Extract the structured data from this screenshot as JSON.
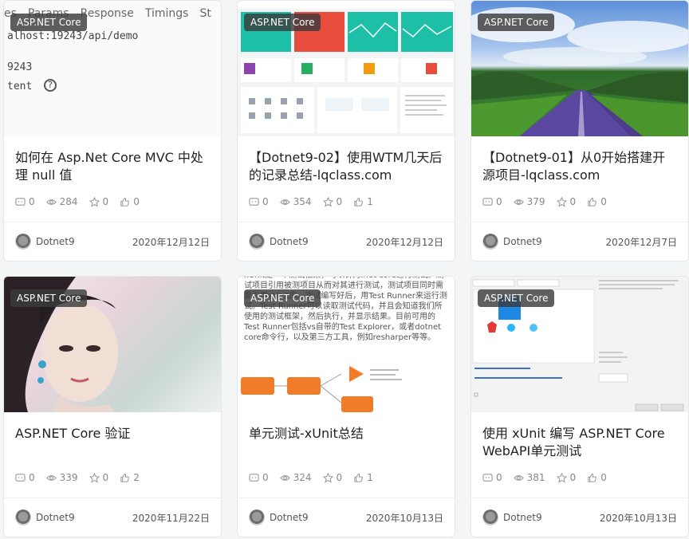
{
  "cards": [
    {
      "tag": "ASP.NET Core",
      "title": "如何在 Asp.Net Core MVC 中处理 null 值",
      "comments": "0",
      "views": "284",
      "stars": "0",
      "likes": "0",
      "author": "Dotnet9",
      "date": "2020年12月12日",
      "thumb_text": {
        "tabs": [
          "es",
          "Params",
          "Response",
          "Timings",
          "St"
        ],
        "lines": [
          "alhost:19243/api/demo",
          "9243",
          "tent"
        ]
      }
    },
    {
      "tag": "ASP.NET Core",
      "title": "【Dotnet9-02】使用WTM几天后的记录总结-lqclass.com",
      "comments": "0",
      "views": "354",
      "stars": "0",
      "likes": "1",
      "author": "Dotnet9",
      "date": "2020年12月12日"
    },
    {
      "tag": "ASP.NET Core",
      "title": "【Dotnet9-01】从0开始搭建开源项目-lqclass.com",
      "comments": "0",
      "views": "379",
      "stars": "0",
      "likes": "0",
      "author": "Dotnet9",
      "date": "2020年12月7日"
    },
    {
      "tag": "ASP.NET Core",
      "title": "ASP.NET Core 验证",
      "comments": "0",
      "views": "339",
      "stars": "0",
      "likes": "2",
      "author": "Dotnet9",
      "date": "2020年11月22日"
    },
    {
      "tag": "ASP.NET Core",
      "title": "单元测试-xUnit总结",
      "comments": "0",
      "views": "324",
      "stars": "0",
      "likes": "1",
      "author": "Dotnet9",
      "date": "2020年10月13日",
      "thumb_text": {
        "para": "xUnit是一个测试框架，可以针对.net core进行测试。测试项目引用被测项目从而对其进行测试，测试项目同时需要引用xUnit库。测试编写好后，用Test Runner来运行测试。Test Runner可以读取测试代码，并且会知道我们所使用的测试框架，然后执行，并显示结果。目前可用的Test Runner包括vs自带的Test Explorer，或者dotnet core命令行，以及第三方工具，例如resharper等等。"
      }
    },
    {
      "tag": "ASP.NET Core",
      "title": "使用 xUnit 编写 ASP.NET Core WebAPI单元测试",
      "comments": "0",
      "views": "381",
      "stars": "0",
      "likes": "0",
      "author": "Dotnet9",
      "date": "2020年10月13日"
    }
  ]
}
